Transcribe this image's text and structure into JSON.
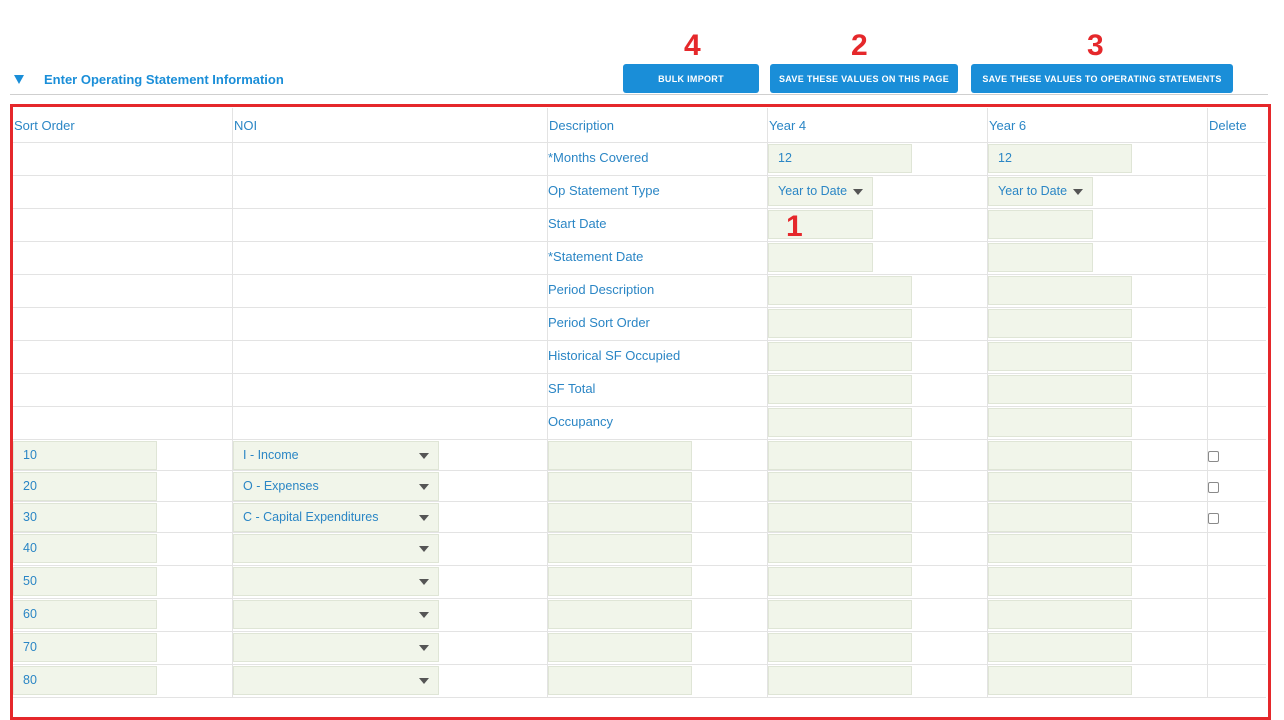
{
  "section": {
    "title": "Enter Operating Statement Information"
  },
  "buttons": {
    "bulk_import": "BULK IMPORT",
    "save_page": "SAVE THESE VALUES ON THIS PAGE",
    "save_operating": "SAVE THESE VALUES TO OPERATING STATEMENTS"
  },
  "annotations": {
    "a1": "1",
    "a2": "2",
    "a3": "3",
    "a4": "4"
  },
  "columns": [
    "Sort Order",
    "NOI",
    "Description",
    "Year 4",
    "Year 6",
    "Delete"
  ],
  "meta_rows": [
    {
      "label": "*Months Covered",
      "year4": "12",
      "year6": "12"
    },
    {
      "label": "Op Statement Type",
      "year4": "Year to Date",
      "year6": "Year to Date"
    },
    {
      "label": "Start Date",
      "year4": "",
      "year6": ""
    },
    {
      "label": "*Statement Date",
      "year4": "",
      "year6": ""
    },
    {
      "label": "Period Description",
      "year4": "",
      "year6": ""
    },
    {
      "label": "Period Sort Order",
      "year4": "",
      "year6": ""
    },
    {
      "label": "Historical SF Occupied",
      "year4": "",
      "year6": ""
    },
    {
      "label": "SF Total",
      "year4": "",
      "year6": ""
    },
    {
      "label": "Occupancy",
      "year4": "",
      "year6": ""
    }
  ],
  "data_rows": [
    {
      "sort": "10",
      "noi": "I - Income",
      "delete_checkbox": true
    },
    {
      "sort": "20",
      "noi": "O - Expenses",
      "delete_checkbox": true
    },
    {
      "sort": "30",
      "noi": "C - Capital Expenditures",
      "delete_checkbox": true
    },
    {
      "sort": "40",
      "noi": "",
      "delete_checkbox": false
    },
    {
      "sort": "50",
      "noi": "",
      "delete_checkbox": false
    },
    {
      "sort": "60",
      "noi": "",
      "delete_checkbox": false
    },
    {
      "sort": "70",
      "noi": "",
      "delete_checkbox": false
    },
    {
      "sort": "80",
      "noi": "",
      "delete_checkbox": false
    }
  ],
  "colors": {
    "accent": "#1a8ed8",
    "annotation": "#e5282b",
    "field_bg": "#f1f5ea"
  }
}
